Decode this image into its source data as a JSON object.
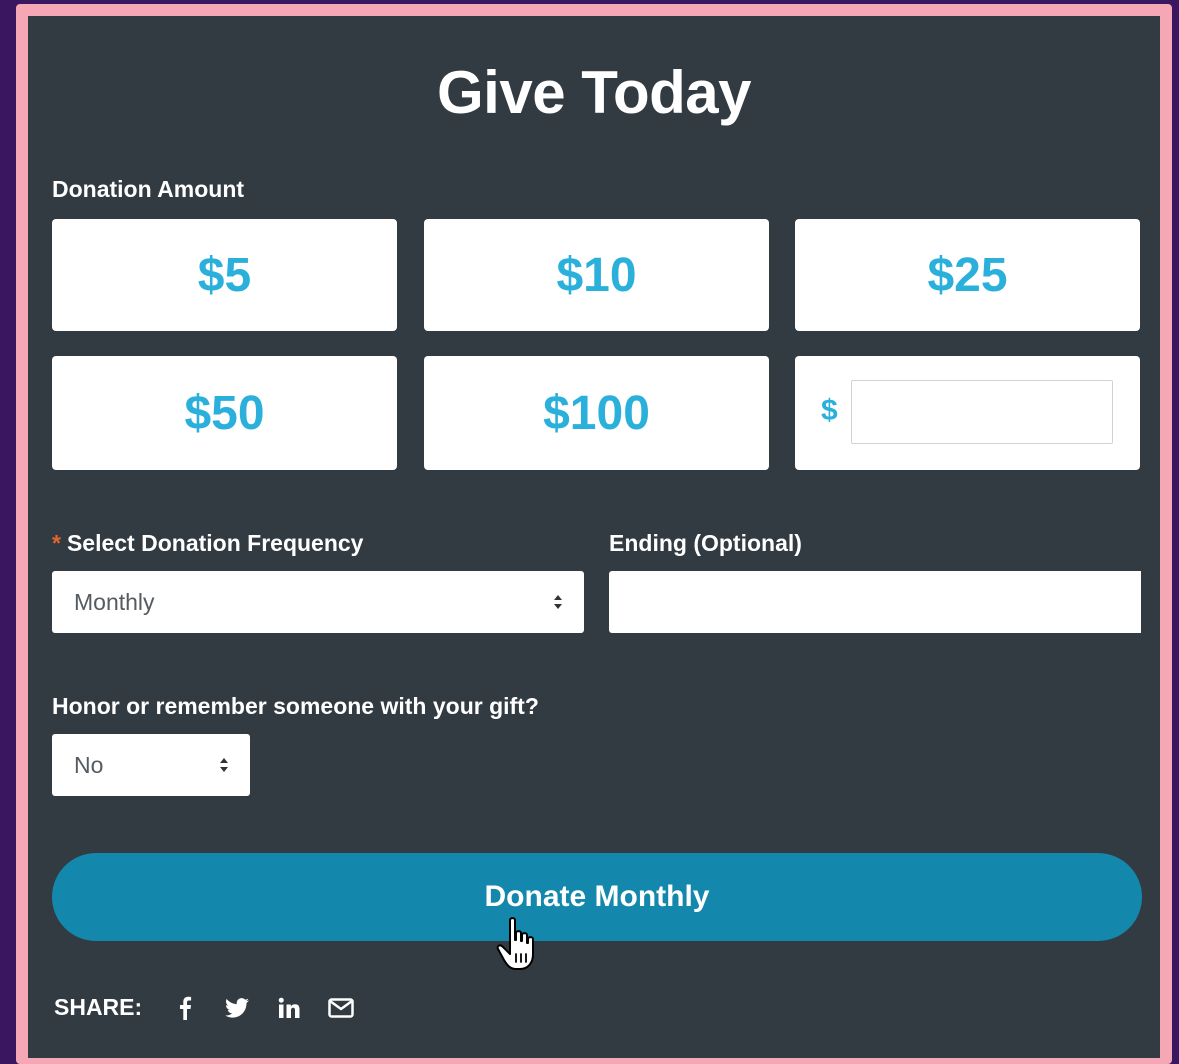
{
  "title": "Give Today",
  "donation_amount": {
    "label": "Donation Amount",
    "options": [
      "$5",
      "$10",
      "$25",
      "$50",
      "$100"
    ],
    "custom_prefix": "$",
    "custom_value": ""
  },
  "frequency": {
    "required_mark": "*",
    "label": "Select Donation Frequency",
    "selected": "Monthly"
  },
  "ending": {
    "label": "Ending (Optional)",
    "value": ""
  },
  "honor": {
    "label": "Honor or remember someone with your gift?",
    "selected": "No"
  },
  "donate_button": "Donate Monthly",
  "share": {
    "label": "SHARE:",
    "icons": [
      "facebook-icon",
      "twitter-icon",
      "linkedin-icon",
      "email-icon"
    ]
  },
  "colors": {
    "background": "#3a1660",
    "frame": "#f6a7b5",
    "panel": "#323a42",
    "amount_text": "#2ab0db",
    "donate_button": "#1488ac",
    "required": "#e2662e"
  }
}
